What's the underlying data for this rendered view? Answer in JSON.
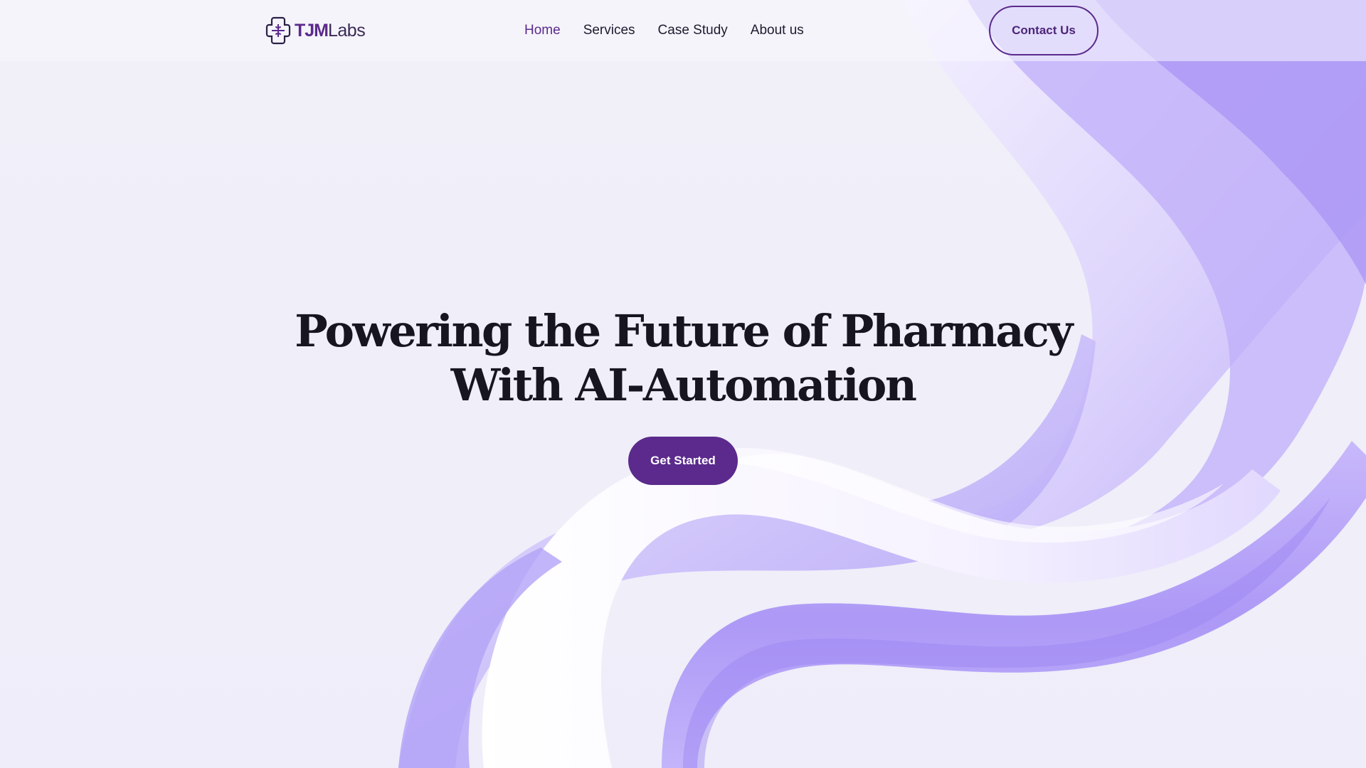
{
  "brand": {
    "name_bold": "TJM",
    "name_light": "Labs",
    "logo_icon": "medical-cross-icon",
    "accent": "#5b2a8c",
    "ribbon_color": "#b6a6f7"
  },
  "nav": {
    "items": [
      {
        "label": "Home",
        "active": true
      },
      {
        "label": "Services",
        "active": false
      },
      {
        "label": "Case Study",
        "active": false
      },
      {
        "label": "About us",
        "active": false
      }
    ]
  },
  "header": {
    "contact_label": "Contact Us"
  },
  "hero": {
    "title_line1": "Powering the Future of Pharmacy",
    "title_line2": "With AI-Automation",
    "cta_label": "Get Started"
  }
}
